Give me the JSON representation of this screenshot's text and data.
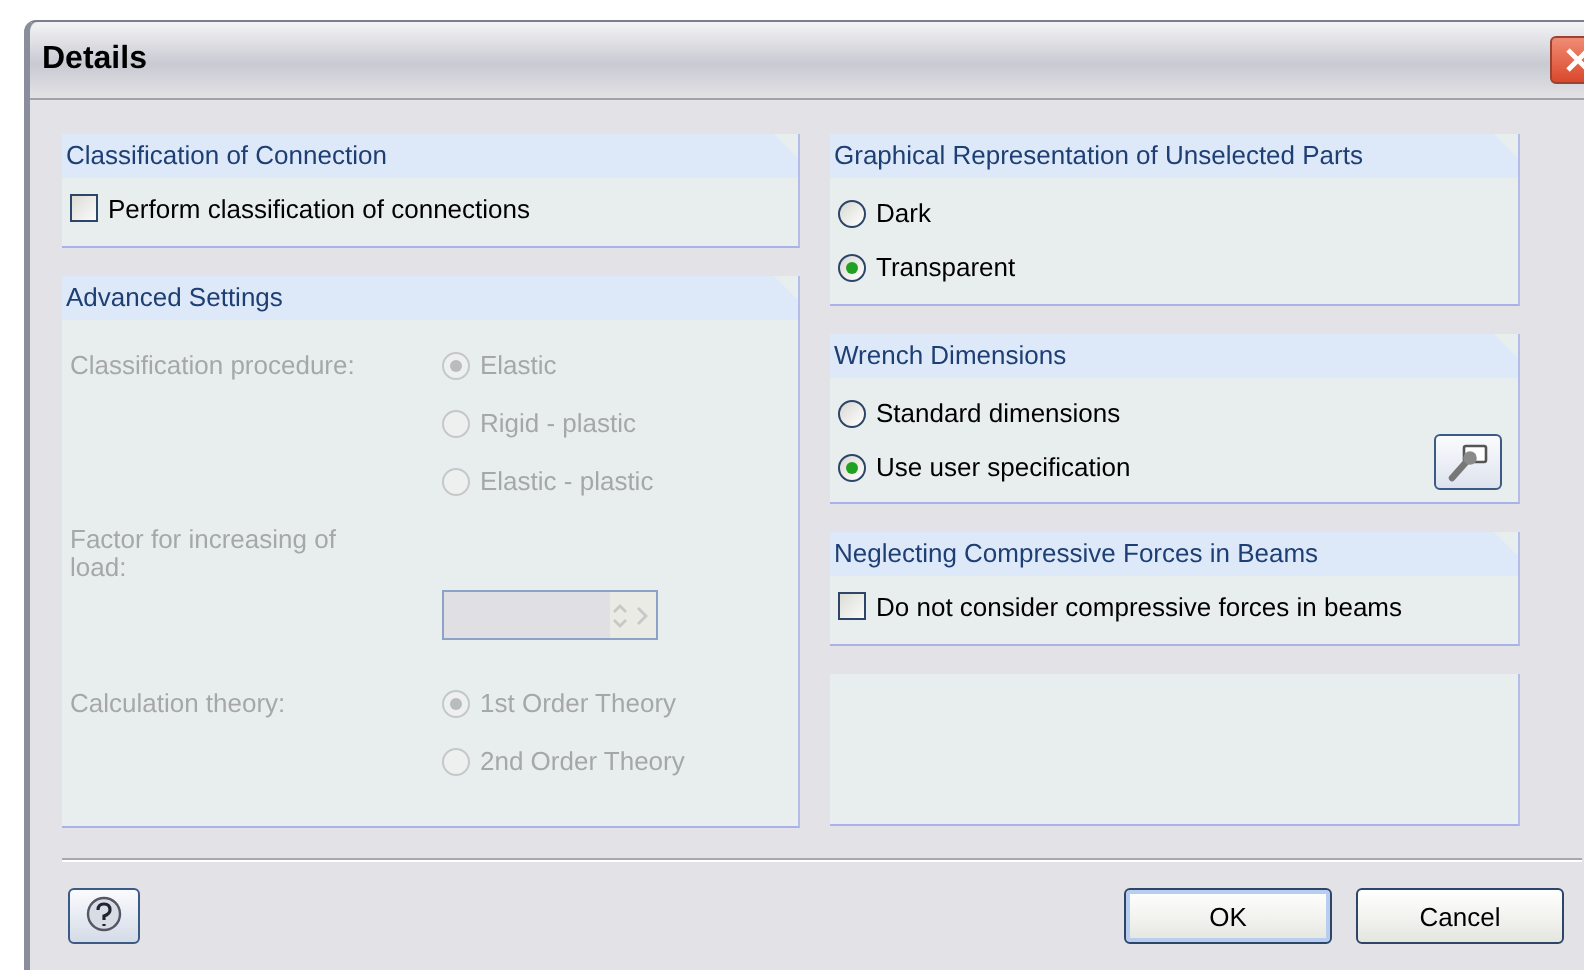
{
  "window": {
    "title": "Details"
  },
  "classification": {
    "title": "Classification of Connection",
    "items": [
      {
        "label": "Perform classification of connections",
        "checked": false
      }
    ]
  },
  "advanced": {
    "title": "Advanced Settings",
    "disabled": true,
    "procedure": {
      "label": "Classification procedure:",
      "options": [
        {
          "label": "Elastic",
          "selected": true
        },
        {
          "label": "Rigid - plastic",
          "selected": false
        },
        {
          "label": "Elastic - plastic",
          "selected": false
        }
      ]
    },
    "factor": {
      "label": "Factor for increasing of load:"
    },
    "theory": {
      "label": "Calculation theory:",
      "options": [
        {
          "label": "1st Order Theory",
          "selected": true
        },
        {
          "label": "2nd Order Theory",
          "selected": false
        }
      ]
    }
  },
  "representation": {
    "title": "Graphical Representation of Unselected Parts",
    "options": [
      {
        "label": "Dark",
        "selected": false
      },
      {
        "label": "Transparent",
        "selected": true
      }
    ]
  },
  "wrench": {
    "title": "Wrench Dimensions",
    "options": [
      {
        "label": "Standard dimensions",
        "selected": false
      },
      {
        "label": "Use user specification",
        "selected": true
      }
    ]
  },
  "neglecting": {
    "title": "Neglecting Compressive Forces in Beams",
    "items": [
      {
        "label": "Do not consider compressive forces in beams",
        "checked": false
      }
    ]
  },
  "buttons": [
    {
      "label": "OK",
      "focused": true
    },
    {
      "label": "Cancel",
      "focused": false
    }
  ]
}
